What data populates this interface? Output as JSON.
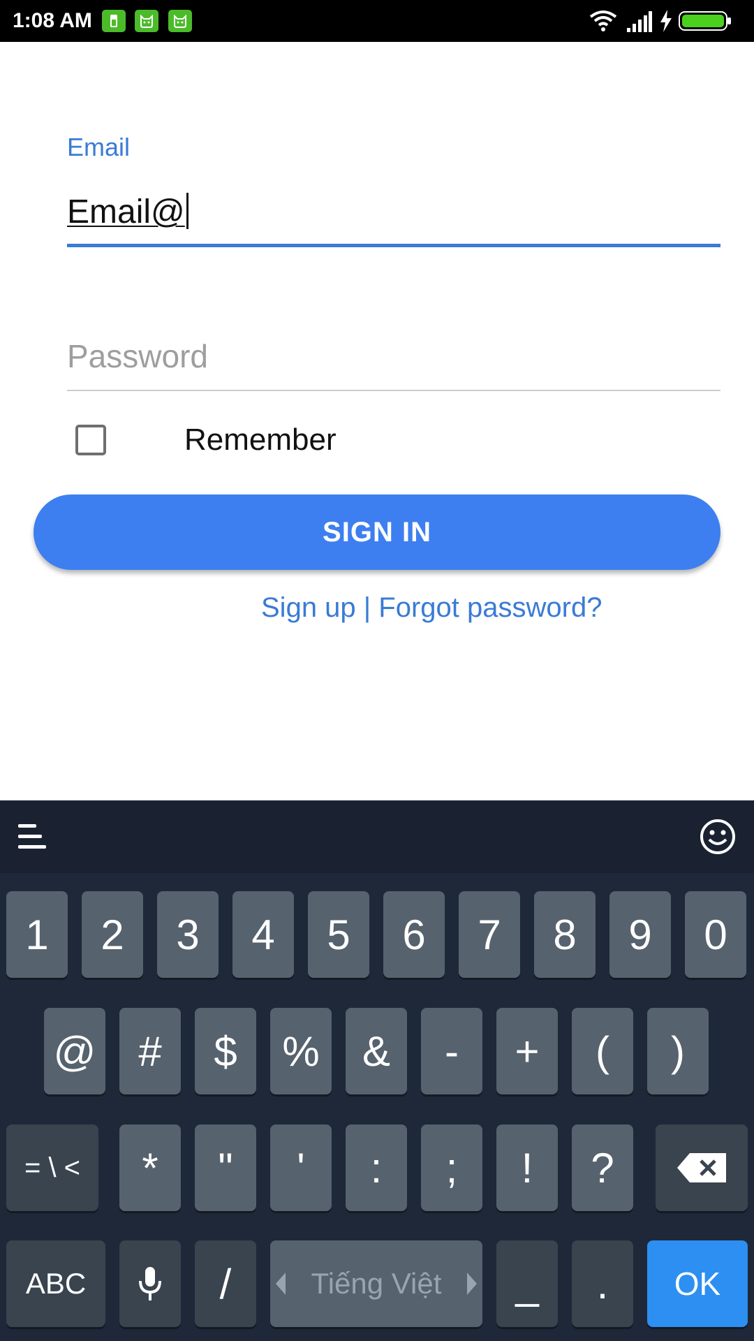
{
  "status_bar": {
    "time": "1:08 AM",
    "notification_icons": [
      "battery-app-icon",
      "android-cat-icon",
      "android-cat-icon"
    ],
    "right_icons": [
      "wifi-icon",
      "signal-icon",
      "charging-icon",
      "battery-icon"
    ]
  },
  "form": {
    "email_label": "Email",
    "email_value": "Email@",
    "password_placeholder": "Password",
    "remember_label": "Remember",
    "remember_checked": false,
    "signin_label": "SIGN IN",
    "signup_link": "Sign up",
    "separator": " | ",
    "forgot_link": "Forgot password?"
  },
  "keyboard": {
    "row1": [
      "1",
      "2",
      "3",
      "4",
      "5",
      "6",
      "7",
      "8",
      "9",
      "0"
    ],
    "row2": [
      "@",
      "#",
      "$",
      "%",
      "&",
      "-",
      "+",
      "(",
      ")"
    ],
    "row3_symbols_key": "= \\ <",
    "row3": [
      "*",
      "\"",
      "'",
      ":",
      ";",
      "!",
      "?"
    ],
    "abc_label": "ABC",
    "slash": "/",
    "space_label": "Tiếng Việt",
    "underscore": "_",
    "period": ".",
    "ok_label": "OK"
  },
  "colors": {
    "accent": "#3a7bd5",
    "button": "#3d7ff0",
    "keyboard_bg": "#1e2838",
    "key": "#56626e",
    "key_dark": "#39444f",
    "ok_key": "#2d8ff2"
  }
}
